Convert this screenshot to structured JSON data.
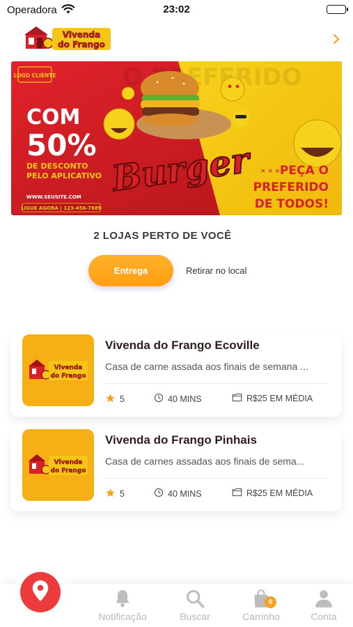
{
  "status_bar": {
    "carrier": "Operadora",
    "time": "23:02"
  },
  "header": {
    "logo_line1": "Vivenda",
    "logo_line2": "do Frango",
    "chevron_icon": "chevron-right-icon",
    "accent": "#f7a21b"
  },
  "banner": {
    "logo_badge": "LOGO CLIENTE",
    "promo_line1": "COM",
    "promo_line2": "50%",
    "promo_line3": "DE DESCONTO",
    "promo_line4": "PELO APLICATIVO",
    "website": "WWW.SEUSITE.COM",
    "phone": "LIGUE AGORA | 123-456-7689",
    "headline": "Burger",
    "cta_line1": "PEÇA O",
    "cta_line2": "PREFERIDO",
    "cta_line3": "DE TODOS!",
    "background_text": "O PREFERIDO"
  },
  "section": {
    "title": "2 LOJAS PERTO DE VOCÊ"
  },
  "tabs": {
    "delivery": "Entrega",
    "pickup": "Retirar no local"
  },
  "stores": [
    {
      "name": "Vivenda do Frango Ecoville",
      "description": "Casa de carne assada aos finais de semana ...",
      "rating": "5",
      "time": "40 MINS",
      "price": "R$25 EM MÉDIA"
    },
    {
      "name": "Vivenda do Frango Pinhais",
      "description": "Casa de carnes assadas aos finais de sema...",
      "rating": "5",
      "time": "40 MINS",
      "price": "R$25 EM MÉDIA"
    }
  ],
  "bottom_nav": {
    "location_icon": "location-pin-icon",
    "items": [
      {
        "label": "Notificação",
        "icon": "bell-icon"
      },
      {
        "label": "Buscar",
        "icon": "search-icon"
      },
      {
        "label": "Carrinho",
        "icon": "shopping-bag-icon",
        "badge": "0"
      },
      {
        "label": "Conta",
        "icon": "user-icon"
      }
    ]
  },
  "colors": {
    "primary_orange": "#f7a21b",
    "brand_red": "#d92027",
    "fab_red": "#ec3b3b",
    "banner_yellow": "#f5c518",
    "inactive_gray": "#b8b8b8"
  }
}
